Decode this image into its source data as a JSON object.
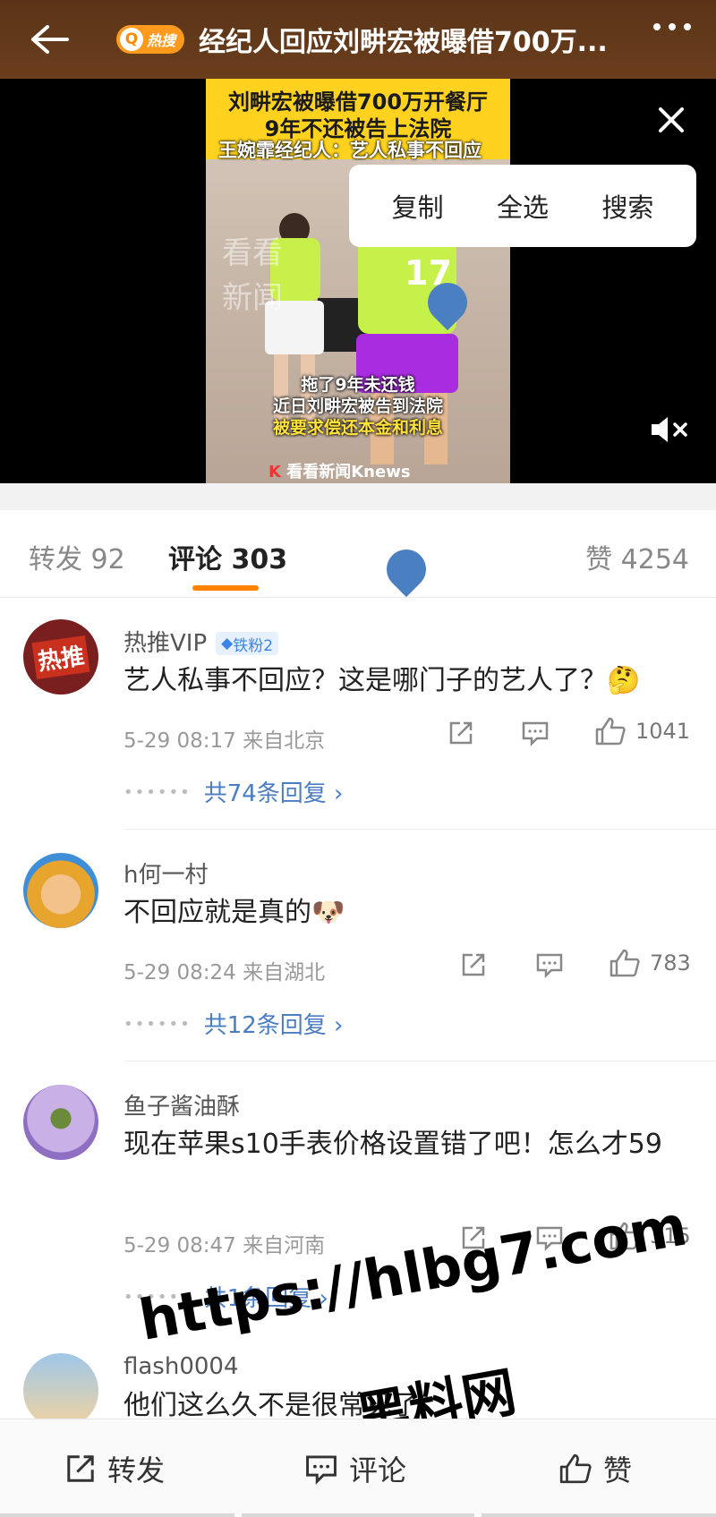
{
  "header": {
    "badge_text": "热搜",
    "title": "经纪人回应刘畊宏被曝借700万..."
  },
  "video": {
    "caption_line1": "刘畊宏被曝借700万开餐厅",
    "caption_line2": "9年不还被告上法院",
    "caption_line3": "王婉霏经纪人：艺人私事不回应",
    "jersey_number": "17",
    "subtitle_line1": "拖了9年未还钱",
    "subtitle_line2": "近日刘畊宏被告到法院",
    "subtitle_line3": "被要求偿还本金和利息",
    "watermark_line1": "看看",
    "watermark_line2": "新闻",
    "brand": "看看新闻Knews"
  },
  "context_menu": {
    "copy": "复制",
    "select_all": "全选",
    "search": "搜索"
  },
  "tabs": {
    "repost": "转发 92",
    "comments": "评论 303",
    "likes": "赞 4254"
  },
  "comments": [
    {
      "name": "热推VIP",
      "badge": "铁粉2",
      "avatar_text": "热推",
      "text": "艺人私事不回应？这是哪门子的艺人了？🤔",
      "time": "5-29 08:17  来自北京",
      "likes": "1041",
      "replies": "共74条回复 ›"
    },
    {
      "name": "h何一村",
      "text": "不回应就是真的🐶",
      "time": "5-29 08:24  来自湖北",
      "likes": "783",
      "replies": "共12条回复 ›"
    },
    {
      "name": "鱼子酱油酥",
      "text": "现在苹果s10手表价格设置错了吧！怎么才59",
      "time": "5-29 08:47  来自河南",
      "likes": "315",
      "replies": "共1条回复 ›"
    },
    {
      "name": "flash0004",
      "text": "他们这么久不是很常见了"
    }
  ],
  "bottom": {
    "repost": "转发",
    "comment": "评论",
    "like": "赞"
  },
  "overlay": {
    "url": "https://hlbg7.com",
    "site": "黑料网"
  },
  "colors": {
    "accent": "#ff8200",
    "link": "#4b7dc3",
    "topbar": "#5a3418"
  }
}
